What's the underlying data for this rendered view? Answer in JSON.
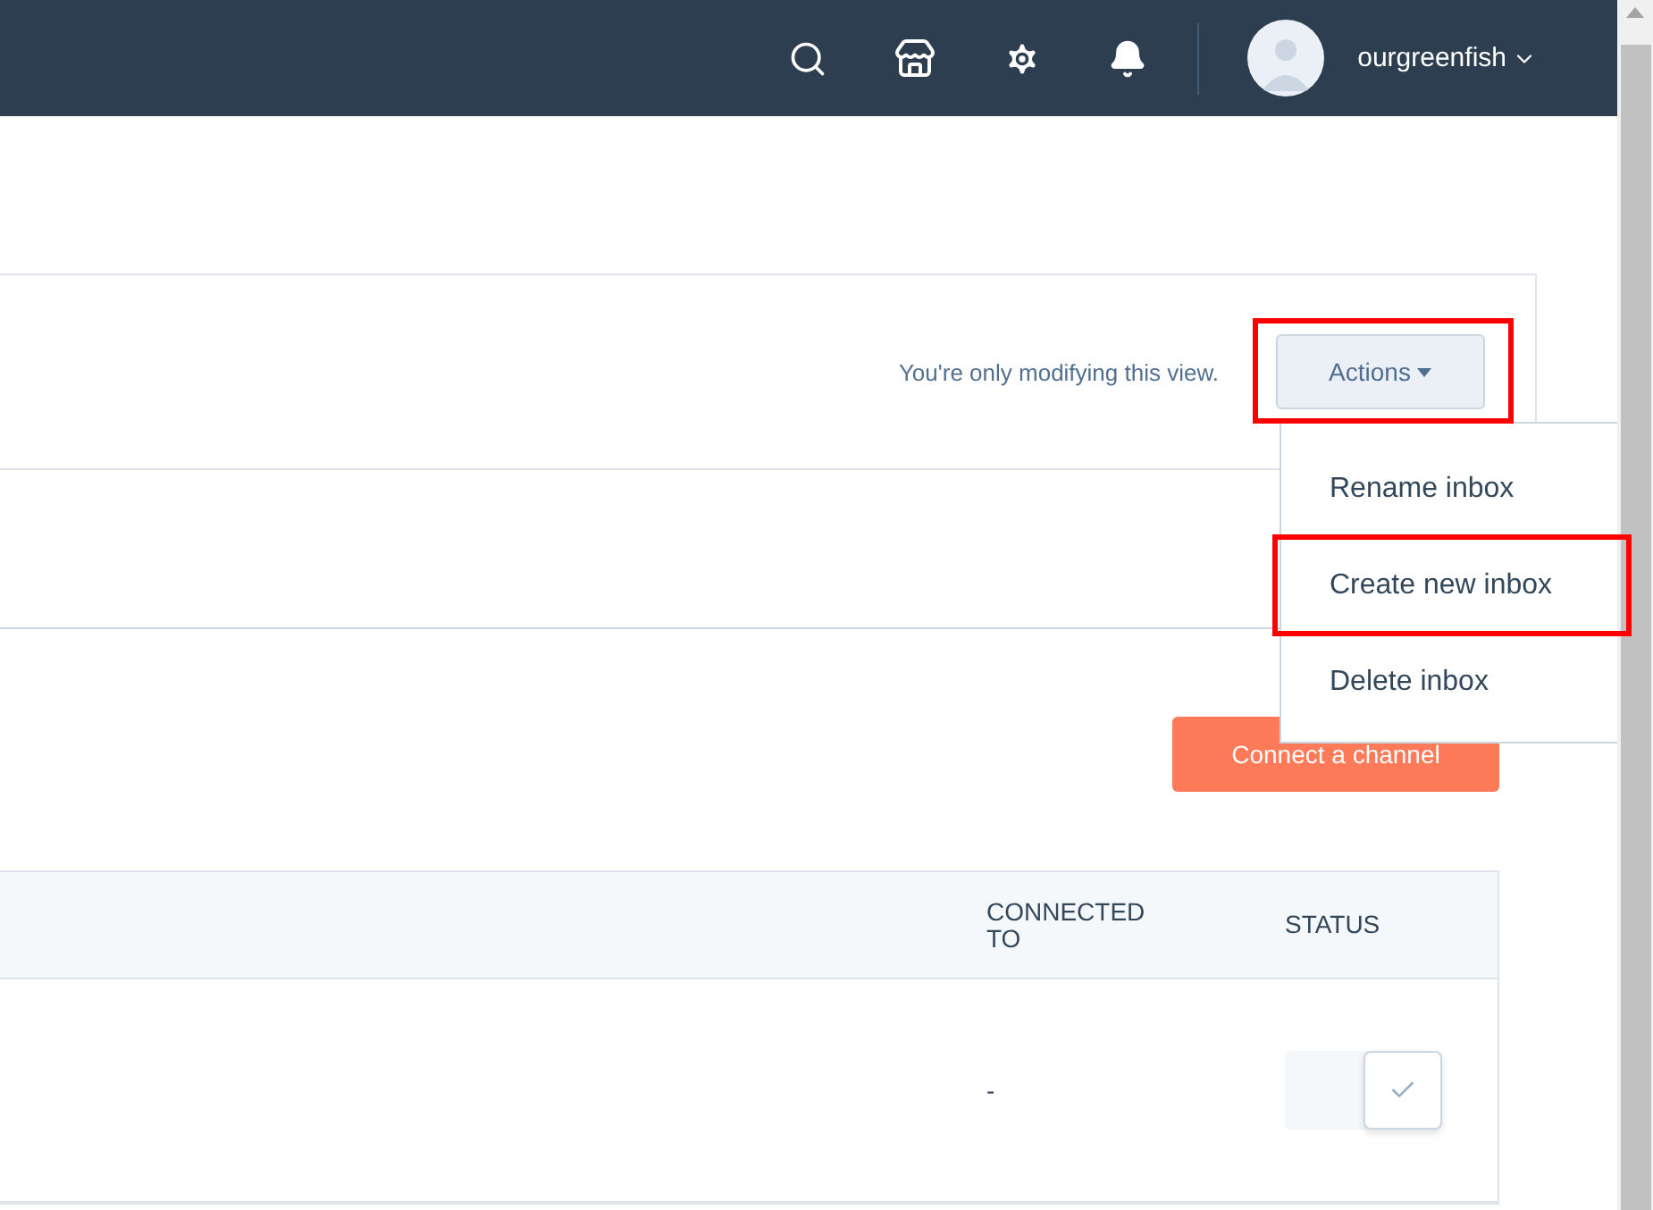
{
  "top_bar": {
    "username": "ourgreenfish"
  },
  "card": {
    "note": "You're only modifying this view.",
    "actions_button": {
      "label": "Actions",
      "highlighted": true
    }
  },
  "connect_button": "Connect a channel",
  "actions_menu": {
    "items": [
      {
        "label": "Rename inbox",
        "highlighted": false
      },
      {
        "label": "Create new inbox",
        "highlighted": true
      },
      {
        "label": "Delete inbox",
        "highlighted": false
      }
    ]
  },
  "table": {
    "columns": [
      "CONNECTED TO",
      "STATUS"
    ],
    "rows": [
      {
        "connected_to": "-",
        "status_on": true
      }
    ]
  }
}
